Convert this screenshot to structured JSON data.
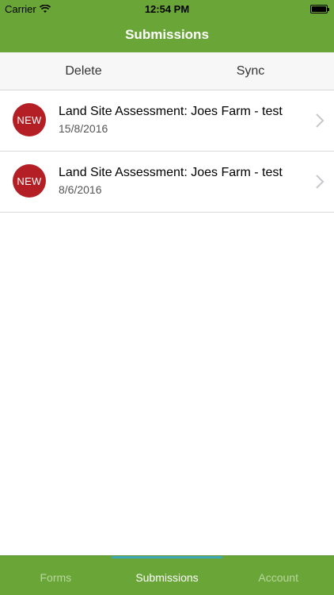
{
  "status_bar": {
    "carrier": "Carrier",
    "time": "12:54 PM",
    "battery_level": 1.0
  },
  "nav": {
    "title": "Submissions"
  },
  "toolbar": {
    "delete_label": "Delete",
    "sync_label": "Sync"
  },
  "submissions": [
    {
      "badge": "NEW",
      "title": "Land Site Assessment: Joes Farm - test",
      "date": "15/8/2016"
    },
    {
      "badge": "NEW",
      "title": "Land Site Assessment: Joes Farm - test",
      "date": "8/6/2016"
    }
  ],
  "tabs": [
    {
      "label": "Forms",
      "active": false
    },
    {
      "label": "Submissions",
      "active": true
    },
    {
      "label": "Account",
      "active": false
    }
  ],
  "colors": {
    "brand": "#6aa537",
    "badge": "#b31f24",
    "tab_indicator": "#3fa8b8"
  }
}
